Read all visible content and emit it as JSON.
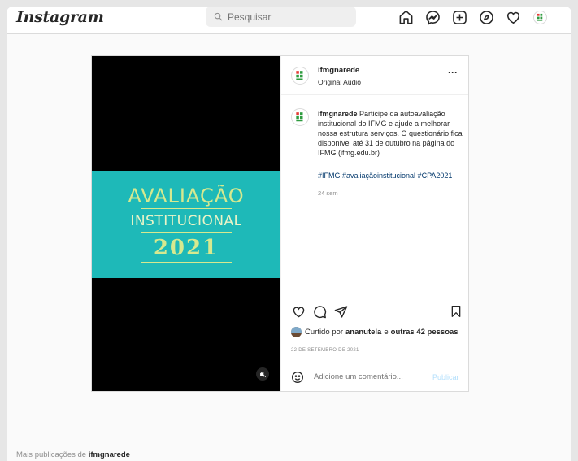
{
  "header": {
    "logo": "Instagram",
    "search_placeholder": "Pesquisar"
  },
  "post": {
    "media": {
      "line1": "AVALIAÇÃO",
      "line2": "INSTITUCIONAL",
      "year": "2021"
    },
    "username": "ifmgnarede",
    "audio": "Original Audio",
    "caption_user": "ifmgnarede",
    "caption_text": "Participe da autoavaliação institucional do IFMG e ajude a melhorar nossa estrutura serviços. O questionário fica disponível até 31 de outubro na página do IFMG (ifmg.edu.br)",
    "hashtags": "#IFMG #avaliaçãoinstitucional #CPA2021",
    "age": "24 sem",
    "liked_prefix": "Curtido por",
    "liked_user": "ananutela",
    "liked_mid": "e",
    "liked_rest": "outras 42 pessoas",
    "date": "22 DE SETEMBRO DE 2021",
    "comment_placeholder": "Adicione um comentário...",
    "publish_label": "Publicar"
  },
  "footer": {
    "more_prefix": "Mais publicações de",
    "more_user": "ifmgnarede"
  },
  "colors": {
    "banner": "#1eb9b8",
    "banner_text": "#d6e98f",
    "link": "#00376b",
    "publish": "#b2dffc"
  }
}
